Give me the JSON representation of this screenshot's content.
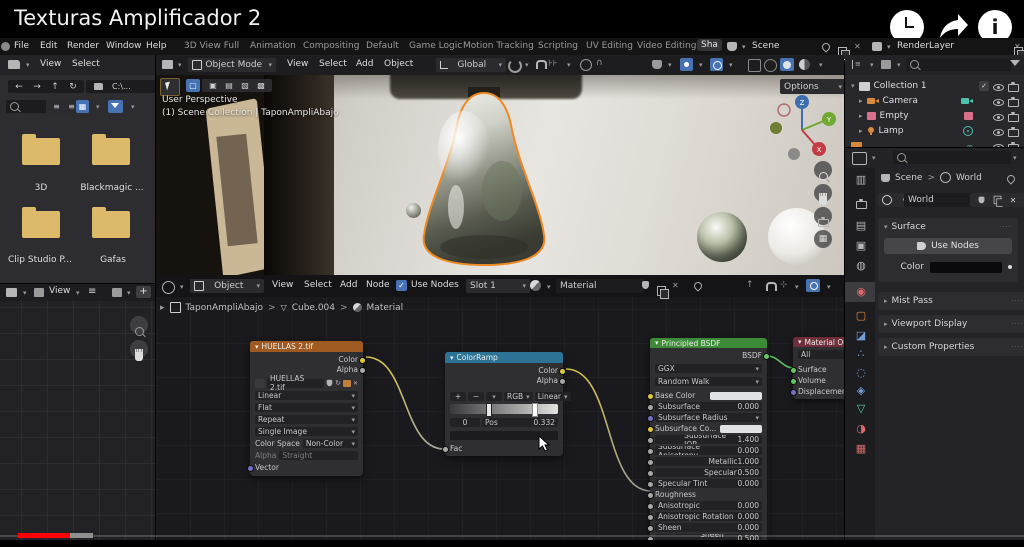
{
  "icons": {
    "chevron_down": "▾",
    "chevron_right": "▸",
    "breadcrumb_sep": ">",
    "check": "✓",
    "close": "✕",
    "plus": "+",
    "minus": "−",
    "arrow_left": "←",
    "arrow_right": "→",
    "arrow_up": "↑",
    "refresh": "↻",
    "menu": "≡",
    "dots_grip": "····",
    "dot": "•",
    "info": "i"
  },
  "youtube": {
    "title": "Texturas Amplificador 2"
  },
  "topbar": {
    "menus": [
      "File",
      "Edit",
      "Render",
      "Window",
      "Help"
    ],
    "workspaces": [
      "3D View Full",
      "Animation",
      "Compositing",
      "Default",
      "Game Logic",
      "Motion Tracking",
      "Scripting",
      "UV Editing",
      "Video Editing"
    ],
    "active_workspace": "Sha",
    "scene_name": "Scene",
    "render_layer_name": "RenderLayer"
  },
  "file_browser": {
    "menus": [
      "View",
      "Select"
    ],
    "path": "C:\\...",
    "folders": [
      "3D",
      "Blackmagic ...",
      "Clip Studio P...",
      "Gafas"
    ]
  },
  "image_editor": {
    "view_menu": "View",
    "new_button": "+"
  },
  "viewport": {
    "mode": "Object Mode",
    "menus": [
      "View",
      "Select",
      "Add",
      "Object"
    ],
    "orientation": "Global",
    "options_button": "Options",
    "overlay_line1": "User Perspective",
    "overlay_line2": "(1) Scene Collection | TaponAmpliAbajo",
    "gizmo": {
      "x": "X",
      "y": "Y",
      "z": "Z"
    }
  },
  "node_editor": {
    "object_selector": "Object",
    "menus": [
      "View",
      "Select",
      "Add",
      "Node"
    ],
    "use_nodes_label": "Use Nodes",
    "slot": "Slot 1",
    "material_name": "Material",
    "breadcrumb": [
      "TaponAmpliAbajo",
      "Cube.004",
      "Material"
    ]
  },
  "nodes": {
    "image_texture": {
      "title": "HUELLAS 2.tif",
      "output_color": "Color",
      "output_alpha": "Alpha",
      "image_name": "HUELLAS 2.tif",
      "interpolation": "Linear",
      "projection": "Flat",
      "extension": "Repeat",
      "source": "Single Image",
      "color_space_label": "Color Space",
      "color_space": "Non-Color",
      "alpha_label": "Alpha",
      "alpha_mode": "Straight",
      "input_vector": "Vector"
    },
    "color_ramp": {
      "title": "ColorRamp",
      "output_color": "Color",
      "output_alpha": "Alpha",
      "color_mode": "RGB",
      "interpolation": "Linear",
      "active_index": "0",
      "pos_label": "Pos",
      "pos_value": "0.332",
      "input_fac": "Fac"
    },
    "principled": {
      "title": "Principled BSDF",
      "output": "BSDF",
      "distribution": "GGX",
      "sss_method": "Random Walk",
      "rows": [
        {
          "label": "Base Color"
        },
        {
          "label": "Subsurface",
          "value": "0.000"
        },
        {
          "label": "Subsurface Radius"
        },
        {
          "label": "Subsurface Co..."
        },
        {
          "label": "Subsurface IOR",
          "value": "1.400"
        },
        {
          "label": "Subsurface Anisotropy",
          "value": "0.000"
        },
        {
          "label": "Metallic",
          "value": "1.000"
        },
        {
          "label": "Specular",
          "value": "0.500"
        },
        {
          "label": "Specular Tint",
          "value": "0.000"
        },
        {
          "label": "Roughness"
        },
        {
          "label": "Anisotropic",
          "value": "0.000"
        },
        {
          "label": "Anisotropic Rotation",
          "value": "0.000"
        },
        {
          "label": "Sheen",
          "value": "0.000"
        },
        {
          "label": "Sheen Tint",
          "value": "0.500"
        }
      ]
    },
    "material_output": {
      "title": "Material Outp",
      "target": "All",
      "inputs": [
        "Surface",
        "Volume",
        "Displacement"
      ]
    }
  },
  "outliner": {
    "collection": "Collection 1",
    "items": [
      "Camera",
      "Empty",
      "Lamp"
    ]
  },
  "properties": {
    "breadcrumb_scene": "Scene",
    "breadcrumb_world": "World",
    "world_name": "World",
    "surface_panel": "Surface",
    "use_nodes_button": "Use Nodes",
    "color_label": "Color",
    "collapsed_panels": [
      "Mist Pass",
      "Viewport Display",
      "Custom Properties"
    ]
  }
}
